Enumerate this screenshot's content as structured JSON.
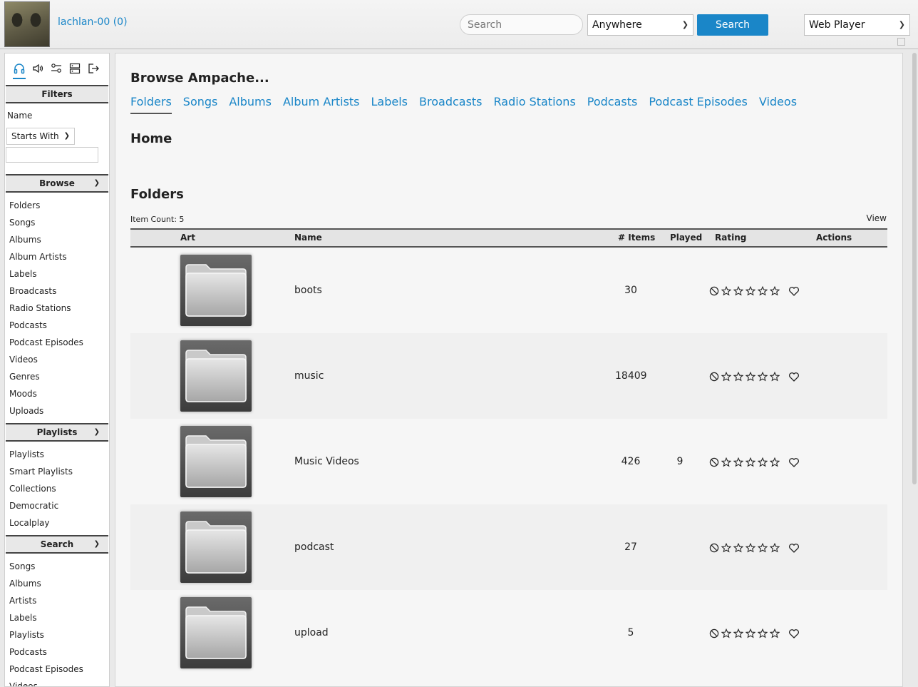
{
  "header": {
    "username": "lachlan-00 (0)",
    "search_placeholder": "Search",
    "scope_value": "Anywhere",
    "search_button": "Search",
    "player_value": "Web Player"
  },
  "sidebar": {
    "tabs": [
      "headphones-icon",
      "speaker-icon",
      "preferences-icon",
      "admin-icon",
      "logout-icon"
    ],
    "filters": {
      "title": "Filters",
      "name_label": "Name",
      "match_value": "Starts With",
      "value": ""
    },
    "browse": {
      "title": "Browse",
      "items": [
        "Folders",
        "Songs",
        "Albums",
        "Album Artists",
        "Labels",
        "Broadcasts",
        "Radio Stations",
        "Podcasts",
        "Podcast Episodes",
        "Videos",
        "Genres",
        "Moods",
        "Uploads"
      ]
    },
    "playlists": {
      "title": "Playlists",
      "items": [
        "Playlists",
        "Smart Playlists",
        "Collections",
        "Democratic",
        "Localplay"
      ]
    },
    "search": {
      "title": "Search",
      "items": [
        "Songs",
        "Albums",
        "Artists",
        "Labels",
        "Playlists",
        "Podcasts",
        "Podcast Episodes",
        "Videos"
      ]
    }
  },
  "main": {
    "browse_title": "Browse Ampache...",
    "tabs": [
      "Folders",
      "Songs",
      "Albums",
      "Album Artists",
      "Labels",
      "Broadcasts",
      "Radio Stations",
      "Podcasts",
      "Podcast Episodes",
      "Videos"
    ],
    "active_tab": "Folders",
    "home_heading": "Home",
    "section_heading": "Folders",
    "item_count": "Item Count: 5",
    "view_label": "View",
    "columns": {
      "art": "Art",
      "name": "Name",
      "items": "# Items",
      "played": "Played",
      "rating": "Rating",
      "actions": "Actions"
    },
    "rows": [
      {
        "name": "boots",
        "items": "30",
        "played": "",
        "rating": 0,
        "favorite": false
      },
      {
        "name": "music",
        "items": "18409",
        "played": "",
        "rating": 0,
        "favorite": false
      },
      {
        "name": "Music Videos",
        "items": "426",
        "played": "9",
        "rating": 0,
        "favorite": false
      },
      {
        "name": "podcast",
        "items": "27",
        "played": "",
        "rating": 0,
        "favorite": false
      },
      {
        "name": "upload",
        "items": "5",
        "played": "",
        "rating": 0,
        "favorite": false
      }
    ]
  },
  "colors": {
    "accent": "#1a86c8"
  }
}
